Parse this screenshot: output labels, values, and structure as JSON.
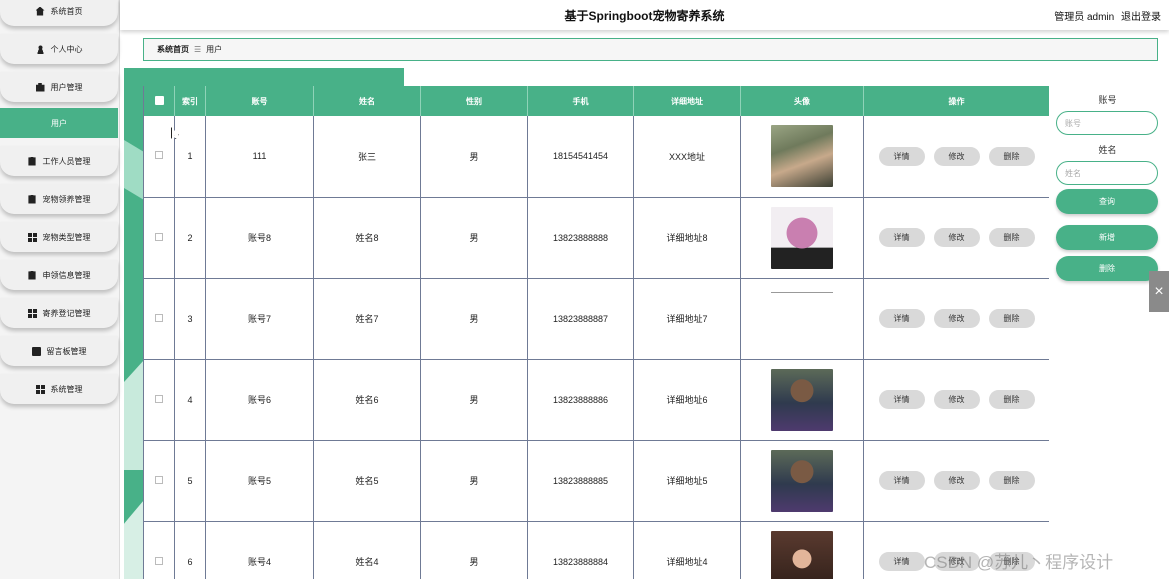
{
  "header": {
    "title": "基于Springboot宠物寄养系统",
    "user": "管理员 admin",
    "logout": "退出登录"
  },
  "sidebar": {
    "items": [
      {
        "label": "系统首页",
        "icon": "home-icon"
      },
      {
        "label": "个人中心",
        "icon": "user-icon"
      },
      {
        "label": "用户管理",
        "icon": "briefcase-icon"
      },
      {
        "label": "用户",
        "icon": "",
        "active": true
      },
      {
        "label": "工作人员管理",
        "icon": "clipboard-icon"
      },
      {
        "label": "宠物领养管理",
        "icon": "clipboard-icon"
      },
      {
        "label": "宠物类型管理",
        "icon": "grid-icon"
      },
      {
        "label": "申领信息管理",
        "icon": "clipboard-icon"
      },
      {
        "label": "寄养登记管理",
        "icon": "grid-icon"
      },
      {
        "label": "留言板管理",
        "icon": "checkbox-icon"
      },
      {
        "label": "系统管理",
        "icon": "grid-icon"
      }
    ]
  },
  "breadcrumb": {
    "home": "系统首页",
    "sep": "☰",
    "current": "用户"
  },
  "table": {
    "columns": [
      "索引",
      "账号",
      "姓名",
      "性别",
      "手机",
      "详细地址",
      "头像",
      "操作"
    ],
    "rows": [
      {
        "index": "1",
        "account": "111",
        "name": "张三",
        "gender": "男",
        "phone": "18154541454",
        "address": "XXX地址"
      },
      {
        "index": "2",
        "account": "账号8",
        "name": "姓名8",
        "gender": "男",
        "phone": "13823888888",
        "address": "详细地址8"
      },
      {
        "index": "3",
        "account": "账号7",
        "name": "姓名7",
        "gender": "男",
        "phone": "13823888887",
        "address": "详细地址7"
      },
      {
        "index": "4",
        "account": "账号6",
        "name": "姓名6",
        "gender": "男",
        "phone": "13823888886",
        "address": "详细地址6"
      },
      {
        "index": "5",
        "account": "账号5",
        "name": "姓名5",
        "gender": "男",
        "phone": "13823888885",
        "address": "详细地址5"
      },
      {
        "index": "6",
        "account": "账号4",
        "name": "姓名4",
        "gender": "男",
        "phone": "13823888884",
        "address": "详细地址4"
      }
    ],
    "actions": {
      "detail": "详情",
      "edit": "修改",
      "delete": "删除"
    }
  },
  "search": {
    "account_label": "账号",
    "account_placeholder": "账号",
    "name_label": "姓名",
    "name_placeholder": "姓名",
    "query": "查询",
    "add": "新增",
    "delete": "删除"
  },
  "edge_tab": "×",
  "watermark": "CSDN @苏儿丶程序设计",
  "colors": {
    "accent": "#48b188",
    "button_gray": "#d9d9d9"
  }
}
